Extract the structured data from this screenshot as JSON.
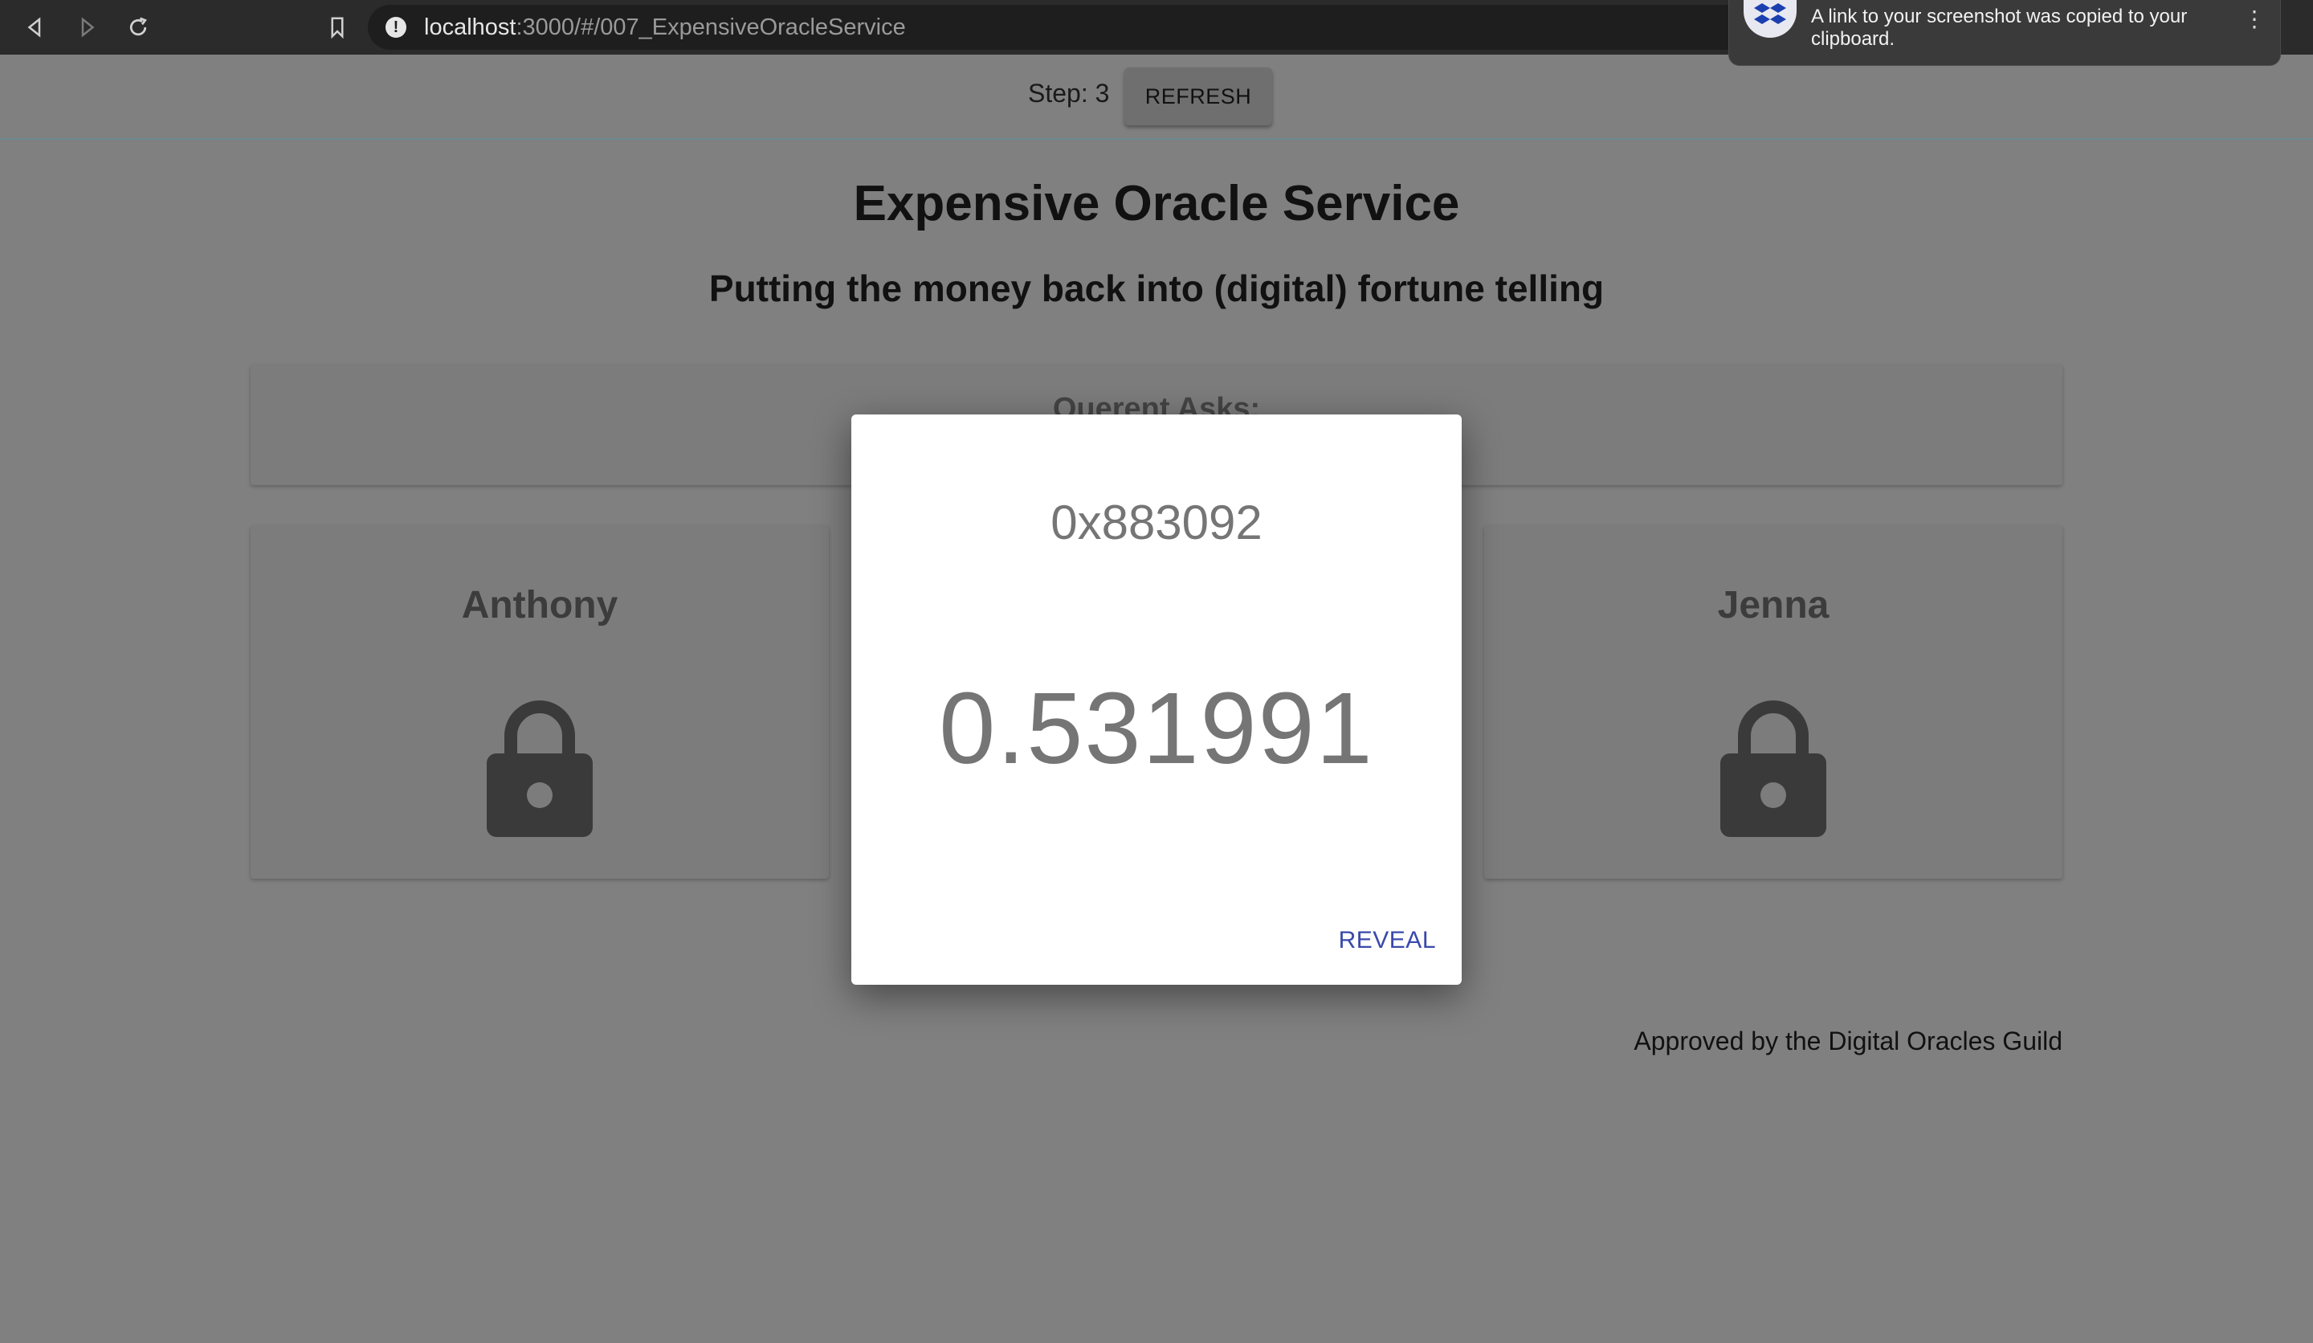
{
  "browser": {
    "url_host": "localhost",
    "url_rest": ":3000/#/007_ExpensiveOracleService"
  },
  "notification": {
    "text": "A link to your screenshot was copied to your clipboard.",
    "menu": "⋮"
  },
  "step_bar": {
    "step_label": "Step: 3",
    "refresh_label": "REFRESH"
  },
  "page": {
    "title": "Expensive Oracle Service",
    "subtitle": "Putting the money back into (digital) fortune telling"
  },
  "querent": {
    "label": "Querent Asks:"
  },
  "players": [
    {
      "name": "Anthony",
      "status_icon": "lock-icon"
    },
    {
      "name": "Jenna",
      "status_icon": "lock-icon"
    }
  ],
  "footer": {
    "text": "Approved by the Digital Oracles Guild"
  },
  "modal": {
    "address": "0x883092",
    "value": "0.531991",
    "reveal_label": "REVEAL"
  },
  "colors": {
    "overlay": "#808080",
    "accent": "#3949ab",
    "modal_text": "#757575"
  }
}
